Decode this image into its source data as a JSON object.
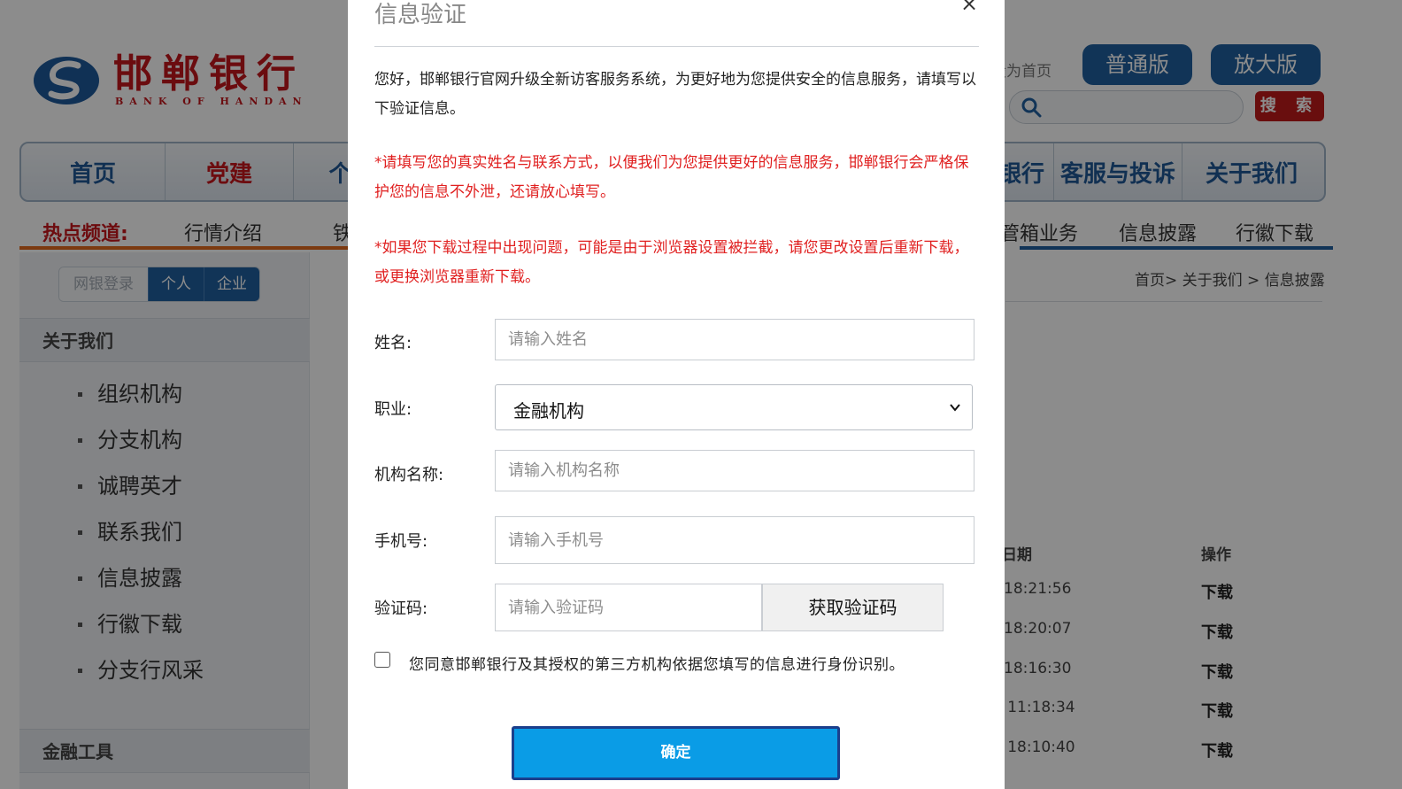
{
  "site": {
    "logo": {
      "cn": "邯郸银行",
      "en": "BANK OF HANDAN",
      "brand_color": "#c3161c"
    },
    "set_home": "设为首页",
    "version_buttons": [
      "普通版",
      "放大版"
    ],
    "search_button": "搜 索",
    "main_nav": [
      "首页",
      "党建",
      "个人",
      "银行",
      "客服与投诉",
      "关于我们"
    ],
    "hot_channel_label": "热点频道:",
    "hot_items": [
      "行情介绍",
      "铁",
      "管箱业务",
      "信息披露",
      "行徽下载"
    ],
    "login_tabs": [
      "网银登录",
      "个人",
      "企业"
    ],
    "sidebar": {
      "section1": "关于我们",
      "items": [
        "组织机构",
        "分支机构",
        "诚聘英才",
        "联系我们",
        "信息披露",
        "行徽下载",
        "分支行风采"
      ],
      "section2": "金融工具"
    },
    "breadcrumb": "首页> 关于我们 > 信息披露",
    "table": {
      "headers": [
        "日期",
        "操作"
      ],
      "rows": [
        {
          "date": ") 18:21:56",
          "action": "下载"
        },
        {
          "date": ") 18:20:07",
          "action": "下载"
        },
        {
          "date": ") 18:16:30",
          "action": "下载"
        },
        {
          "date": "1 11:18:34",
          "action": "下载"
        },
        {
          "date": "7 18:10:40",
          "action": "下载"
        }
      ]
    }
  },
  "modal": {
    "title": "信息验证",
    "close": "×",
    "intro": "您好，邯郸银行官网升级全新访客服务系统，为更好地为您提供安全的信息服务，请填写以下验证信息。",
    "notice1": "*请填写您的真实姓名与联系方式，以便我们为您提供更好的信息服务，邯郸银行会严格保护您的信息不外泄，还请放心填写。",
    "notice2": "*如果您下载过程中出现问题，可能是由于浏览器设置被拦截，请您更改设置后重新下载，或更换浏览器重新下载。",
    "fields": {
      "name": {
        "label": "姓名:",
        "placeholder": "请输入姓名"
      },
      "job": {
        "label": "职业:",
        "value": "金融机构"
      },
      "org": {
        "label": "机构名称:",
        "placeholder": "请输入机构名称"
      },
      "phone": {
        "label": "手机号:",
        "placeholder": "请输入手机号"
      },
      "code": {
        "label": "验证码:",
        "placeholder": "请输入验证码",
        "button": "获取验证码"
      }
    },
    "agreement": "您同意邯郸银行及其授权的第三方机构依据您填写的信息进行身份识别。",
    "agreement_checked": false,
    "confirm": "确定",
    "accent_color": "#0a9ce6"
  }
}
